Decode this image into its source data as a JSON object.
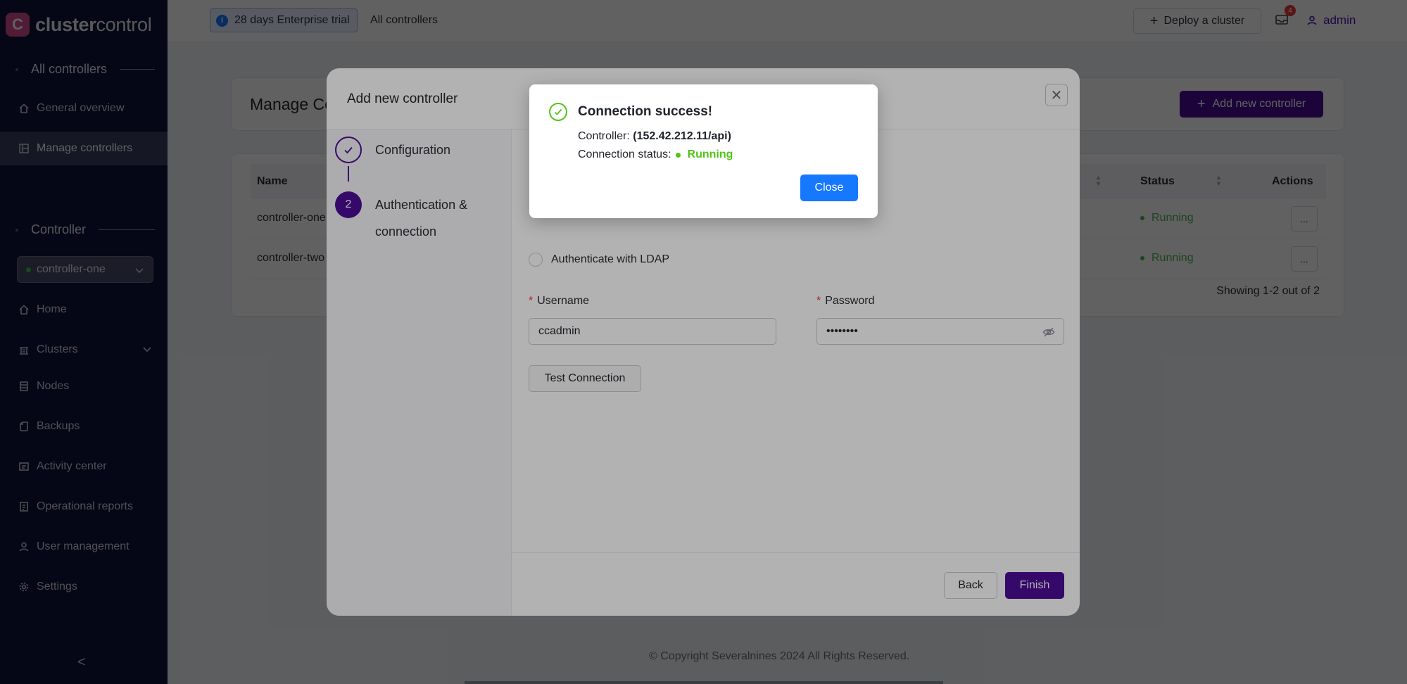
{
  "brand": {
    "logo_letter": "C",
    "name_bold": "cluster",
    "name_light": "control"
  },
  "sidebar": {
    "section_all": "All controllers",
    "top_items": [
      {
        "label": "General overview",
        "icon": "home-icon"
      },
      {
        "label": "Manage controllers",
        "icon": "dashboard-icon"
      }
    ],
    "section_controller": "Controller",
    "controller_select": "controller-one",
    "items": [
      {
        "label": "Home",
        "icon": "home-icon"
      },
      {
        "label": "Clusters",
        "icon": "clusters-icon"
      },
      {
        "label": "Nodes",
        "icon": "nodes-icon"
      },
      {
        "label": "Backups",
        "icon": "backups-icon"
      },
      {
        "label": "Activity center",
        "icon": "activity-icon"
      },
      {
        "label": "Operational reports",
        "icon": "reports-icon"
      },
      {
        "label": "User management",
        "icon": "user-icon"
      },
      {
        "label": "Settings",
        "icon": "gear-icon"
      }
    ],
    "collapse_glyph": "<"
  },
  "topbar": {
    "trial": "28 days Enterprise trial",
    "all_controllers": "All controllers",
    "deploy": "Deploy a cluster",
    "notif_count": "4",
    "user": "admin"
  },
  "main": {
    "title": "Manage Co",
    "add_button": "Add new controller",
    "columns": {
      "name": "Name",
      "status": "Status",
      "actions": "Actions"
    },
    "rows": [
      {
        "name": "controller-one",
        "status": "Running",
        "action": "..."
      },
      {
        "name": "controller-two",
        "status": "Running",
        "action": "..."
      }
    ],
    "showing": "Showing 1-2 out of 2",
    "copyright": "© Copyright Severalnines 2024 All Rights Reserved."
  },
  "modal": {
    "title": "Add new controller",
    "steps": [
      {
        "number": "✓",
        "label": "Configuration"
      },
      {
        "number": "2",
        "label_line1": "Authentication &",
        "label_line2": "connection"
      }
    ],
    "ldap_label": "Authenticate with LDAP",
    "username_label": "Username",
    "username_value": "ccadmin",
    "password_label": "Password",
    "password_value": "••••••••",
    "test_button": "Test Connection",
    "back_button": "Back",
    "finish_button": "Finish"
  },
  "dialog": {
    "title": "Connection success!",
    "controller_label": "Controller:",
    "controller_value": "(152.42.212.11/api)",
    "status_label": "Connection status:",
    "status_value": "Running",
    "close_button": "Close"
  },
  "colors": {
    "accent": "#4c0d99",
    "primary": "#1677ff",
    "success": "#52c41a",
    "sidebar": "#12143b"
  }
}
